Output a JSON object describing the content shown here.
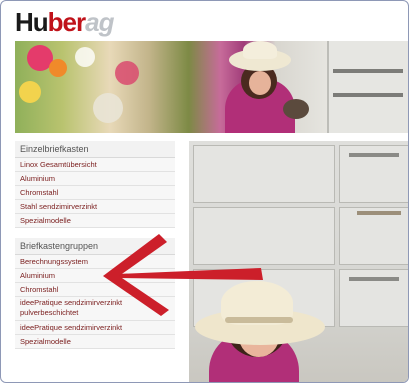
{
  "logo": {
    "part1": "Hu",
    "part2": "ber",
    "part3": "ag"
  },
  "sidebar": {
    "section1": {
      "title": "Einzelbriefkasten",
      "items": [
        "Linox Gesamtübersicht",
        "Aluminium",
        "Chromstahl",
        "Stahl sendzimirverzinkt",
        "Spezialmodelle"
      ]
    },
    "section2": {
      "title": "Briefkastengruppen",
      "items": [
        "Berechnungssystem",
        "Aluminium",
        "Chromstahl",
        "ideePratique sendzimirverzinkt pulverbeschichtet",
        "ideePratique sendzimirverzinkt",
        "Spezialmodelle"
      ]
    }
  },
  "colors": {
    "link": "#7a1d1d",
    "arrow": "#cc1f2a",
    "brand_red": "#c0121a",
    "frame": "#8e98b6"
  }
}
